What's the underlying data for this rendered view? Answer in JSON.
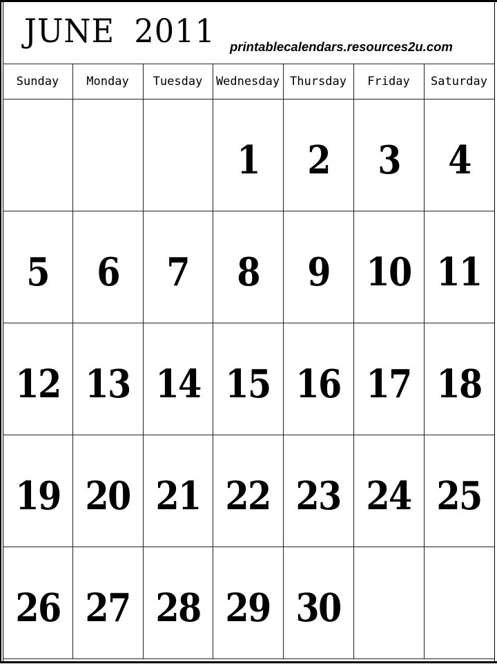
{
  "header": {
    "title": "JUNE 2011",
    "website": "printablecalendars.resources2u.com"
  },
  "weekdays": [
    "Sunday",
    "Monday",
    "Tuesday",
    "Wednesday",
    "Thursday",
    "Friday",
    "Saturday"
  ],
  "weeks": [
    [
      "",
      "",
      "",
      "1",
      "2",
      "3",
      "4"
    ],
    [
      "5",
      "6",
      "7",
      "8",
      "9",
      "10",
      "11"
    ],
    [
      "12",
      "13",
      "14",
      "15",
      "16",
      "17",
      "18"
    ],
    [
      "19",
      "20",
      "21",
      "22",
      "23",
      "24",
      "25"
    ],
    [
      "26",
      "27",
      "28",
      "29",
      "30",
      "",
      ""
    ]
  ],
  "colors": {
    "background": "#ffffff",
    "ink": "#000000"
  }
}
